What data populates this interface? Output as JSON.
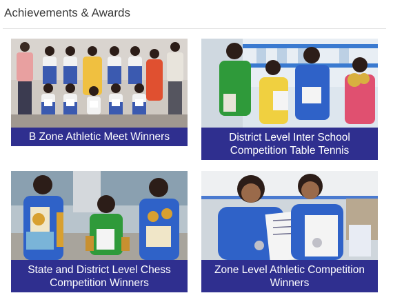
{
  "section": {
    "title": "Achievements & Awards"
  },
  "cards": [
    {
      "caption": "B Zone Athletic Meet Winners",
      "image": "group-photo-students-with-certificates"
    },
    {
      "caption": "District Level Inter School Competition Table Tennis",
      "image": "students-with-trophies-school-building"
    },
    {
      "caption": "State and District Level Chess Competition Winners",
      "image": "students-with-trophies-and-certificates"
    },
    {
      "caption": "Zone Level Athletic Competition Winners",
      "image": "two-girls-with-medals-and-certificates"
    }
  ],
  "colors": {
    "caption_bg": "#2f2f8f",
    "caption_text": "#ffffff",
    "title_text": "#3a3a3a"
  }
}
